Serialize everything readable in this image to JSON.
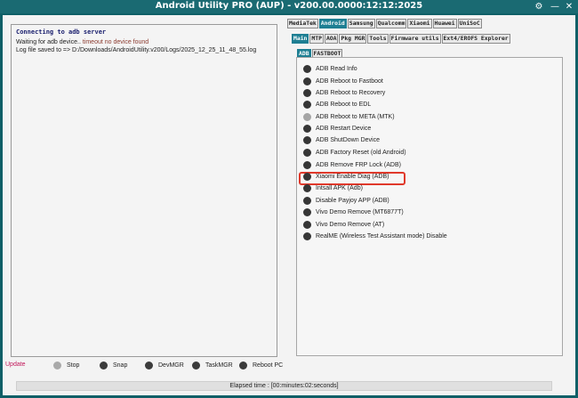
{
  "window": {
    "title": "Android Utility PRO (AUP) - v200.00.0000:12:12:2025",
    "controls": [
      {
        "name": "settings-icon",
        "glyph": "⚙"
      },
      {
        "name": "minimize-icon",
        "glyph": "—"
      },
      {
        "name": "close-icon",
        "glyph": "✕"
      }
    ]
  },
  "log": {
    "heading": "Connecting to adb server",
    "waiting_prefix": "Waiting for adb device.. ",
    "waiting_status": "timeout no device found",
    "logfile_line": "Log file saved to => D:/Downloads/AndroidUtility.v200/Logs/2025_12_25_11_48_55.log"
  },
  "bottom": {
    "update_label": "Update",
    "items": [
      {
        "label": "Stop",
        "state": "disabled"
      },
      {
        "label": "Snap",
        "state": "enabled"
      },
      {
        "label": "DevMGR",
        "state": "enabled"
      },
      {
        "label": "TaskMGR",
        "state": "enabled"
      },
      {
        "label": "Reboot PC",
        "state": "enabled"
      }
    ]
  },
  "status": {
    "elapsed": "Elapsed time : [00:minutes:02:seconds]"
  },
  "vendor_tabs": [
    {
      "label": "MediaTek",
      "active": false
    },
    {
      "label": "Android",
      "active": true
    },
    {
      "label": "Samsung",
      "active": false
    },
    {
      "label": "Qualcomm",
      "active": false
    },
    {
      "label": "Xiaomi",
      "active": false
    },
    {
      "label": "Huawei",
      "active": false
    },
    {
      "label": "UniSoC",
      "active": false
    }
  ],
  "sub_tabs": [
    {
      "label": "Main",
      "active": true
    },
    {
      "label": "MTP",
      "active": false
    },
    {
      "label": "AOA",
      "active": false
    },
    {
      "label": "Pkg MGR",
      "active": false
    },
    {
      "label": "Tools",
      "active": false
    },
    {
      "label": "Firmware utils",
      "active": false
    },
    {
      "label": "Ext4/EROFS Explorer",
      "active": false
    }
  ],
  "adb_tabs": [
    {
      "label": "ADB",
      "active": true
    },
    {
      "label": "FASTBOOT",
      "active": false
    }
  ],
  "commands": [
    {
      "label": "ADB Read Info",
      "state": "enabled"
    },
    {
      "label": "ADB Reboot to Fastboot",
      "state": "enabled"
    },
    {
      "label": "ADB Reboot to Recovery",
      "state": "enabled"
    },
    {
      "label": "ADB Reboot to EDL",
      "state": "enabled"
    },
    {
      "label": "ADB Reboot to META (MTK)",
      "state": "disabled"
    },
    {
      "label": "ADB Restart Device",
      "state": "enabled"
    },
    {
      "label": "ADB ShutDown Device",
      "state": "enabled"
    },
    {
      "label": "ADB Factory Reset (old Android)",
      "state": "enabled"
    },
    {
      "label": "ADB Remove FRP Lock (ADB)",
      "state": "enabled",
      "highlighted": true
    },
    {
      "label": "Xiaomi Enable Diag (ADB)",
      "state": "enabled"
    },
    {
      "label": "Intsall APK (Adb)",
      "state": "enabled"
    },
    {
      "label": "Disable Payjoy APP (ADB)",
      "state": "enabled"
    },
    {
      "label": "Vivo Demo Remove (MT6877T)",
      "state": "enabled"
    },
    {
      "label": "Vivo Demo Remove (AT)",
      "state": "enabled"
    },
    {
      "label": "RealME (Wireless Test Assistant mode) Disable",
      "state": "enabled"
    }
  ],
  "colors": {
    "frame": "#0f5f67",
    "active_tab": "#1e7f93",
    "highlight_box": "#e0392b",
    "warning_text": "#8b3a2e",
    "update_link": "#c2185b"
  }
}
